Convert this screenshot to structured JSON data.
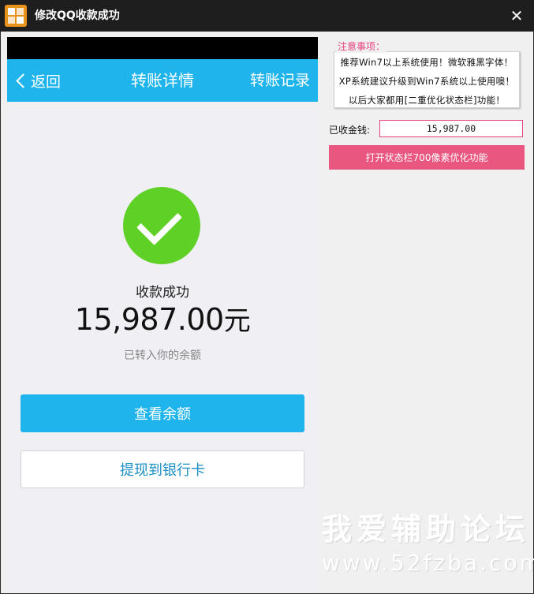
{
  "window": {
    "title": "修改QQ收款成功",
    "icon": "app-logo-icon",
    "close_glyph": "✕"
  },
  "phone": {
    "nav": {
      "back_label": "返回",
      "title": "转账详情",
      "right_label": "转账记录"
    },
    "success_label": "收款成功",
    "amount": "15,987.00",
    "amount_unit": "元",
    "sub_label": "已转入你的余额",
    "primary_button": "查看余额",
    "secondary_button": "提现到银行卡"
  },
  "panel": {
    "notes_title": "注意事项：",
    "notes": [
      "推荐Win7以上系统使用！微软雅黑字体！",
      "XP系统建议升级到Win7系统以上使用噢！",
      "以后大家都用[二重优化状态栏]功能！"
    ],
    "amount_label": "已收金钱:",
    "amount_value": "15,987.00",
    "action_button": "打开状态栏700像素优化功能"
  },
  "watermark": {
    "line1": "我爱辅助论坛",
    "line2": "www.52fzba.com"
  },
  "colors": {
    "accent_blue": "#1fb5ec",
    "success_green": "#5fd126",
    "pink": "#e95680",
    "titlebar": "#1e1e1e"
  }
}
